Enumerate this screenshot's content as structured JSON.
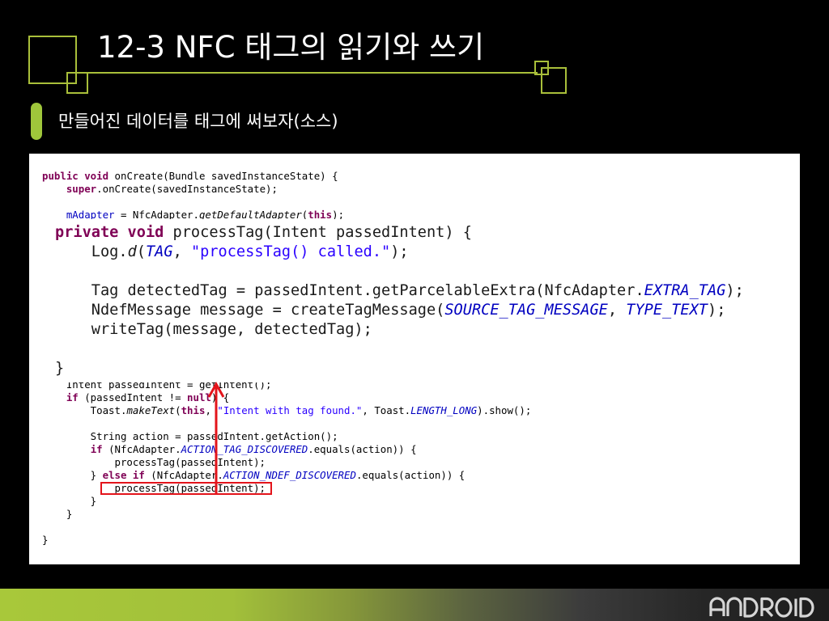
{
  "slide": {
    "title": "12-3 NFC 태그의 읽기와 쓰기",
    "subtitle": "만들어진 데이터를 태그에 써보자(소스)",
    "brand_logo": "android"
  },
  "theme": {
    "accent_line": "#a9bf3a",
    "bullet": "#9fc63b",
    "annotation": "#e3141b"
  },
  "code": {
    "background_top": [
      [
        {
          "t": "public void",
          "color": "#7f0055",
          "b": true
        },
        {
          "t": " onCreate(Bundle savedInstanceState) {"
        }
      ],
      [
        {
          "t": "    "
        },
        {
          "t": "super",
          "color": "#7f0055",
          "b": true
        },
        {
          "t": ".onCreate(savedInstanceState);"
        }
      ],
      [],
      [
        {
          "t": "    "
        },
        {
          "t": "mAdapter",
          "color": "#0000c0"
        },
        {
          "t": " = NfcAdapter."
        },
        {
          "t": "getDefaultAdapter",
          "i": true
        },
        {
          "t": "("
        },
        {
          "t": "this",
          "color": "#7f0055",
          "b": true
        },
        {
          "t": ");"
        }
      ]
    ],
    "overlay": [
      [
        {
          "t": "private void",
          "color": "#7f0055",
          "b": true
        },
        {
          "t": " processTag(Intent passedIntent) {"
        }
      ],
      [
        {
          "t": "    Log."
        },
        {
          "t": "d",
          "i": true
        },
        {
          "t": "("
        },
        {
          "t": "TAG",
          "color": "#0000c0",
          "i": true
        },
        {
          "t": ", "
        },
        {
          "t": "\"processTag() called.\"",
          "color": "#2a00ff"
        },
        {
          "t": ");"
        }
      ],
      [],
      [
        {
          "t": "    Tag detectedTag = passedIntent.getParcelableExtra(NfcAdapter."
        },
        {
          "t": "EXTRA_TAG",
          "color": "#0000c0",
          "i": true
        },
        {
          "t": ");"
        }
      ],
      [
        {
          "t": "    NdefMessage message = createTagMessage("
        },
        {
          "t": "SOURCE_TAG_MESSAGE",
          "color": "#0000c0",
          "i": true
        },
        {
          "t": ", "
        },
        {
          "t": "TYPE_TEXT",
          "color": "#0000c0",
          "i": true
        },
        {
          "t": ");"
        }
      ],
      [
        {
          "t": "    writeTag(message, detectedTag);"
        }
      ],
      [],
      [
        {
          "t": "}"
        }
      ]
    ],
    "background_bottom": [
      [
        {
          "t": "    Intent passedIntent = getIntent();"
        }
      ],
      [
        {
          "t": "    "
        },
        {
          "t": "if",
          "color": "#7f0055",
          "b": true
        },
        {
          "t": " (passedIntent != "
        },
        {
          "t": "null",
          "color": "#7f0055",
          "b": true
        },
        {
          "t": ") {"
        }
      ],
      [
        {
          "t": "        Toast."
        },
        {
          "t": "makeText",
          "i": true
        },
        {
          "t": "("
        },
        {
          "t": "this",
          "color": "#7f0055",
          "b": true
        },
        {
          "t": ", "
        },
        {
          "t": "\"Intent with tag found.\"",
          "color": "#2a00ff"
        },
        {
          "t": ", Toast."
        },
        {
          "t": "LENGTH_LONG",
          "color": "#0000c0",
          "i": true
        },
        {
          "t": ").show();"
        }
      ],
      [],
      [
        {
          "t": "        String action = passedIntent.getAction();"
        }
      ],
      [
        {
          "t": "        "
        },
        {
          "t": "if",
          "color": "#7f0055",
          "b": true
        },
        {
          "t": " (NfcAdapter."
        },
        {
          "t": "ACTION_TAG_DISCOVERED",
          "color": "#0000c0",
          "i": true
        },
        {
          "t": ".equals(action)) {"
        }
      ],
      [
        {
          "t": "            processTag(passedIntent);"
        }
      ],
      [
        {
          "t": "        } "
        },
        {
          "t": "else if",
          "color": "#7f0055",
          "b": true
        },
        {
          "t": " (NfcAdapter."
        },
        {
          "t": "ACTION_NDEF_DISCOVERED",
          "color": "#0000c0",
          "i": true
        },
        {
          "t": ".equals(action)) {"
        }
      ],
      [
        {
          "t": "            processTag(passedIntent);"
        }
      ],
      [
        {
          "t": "        }"
        }
      ],
      [
        {
          "t": "    }"
        }
      ],
      [],
      [
        {
          "t": "}"
        }
      ]
    ]
  }
}
